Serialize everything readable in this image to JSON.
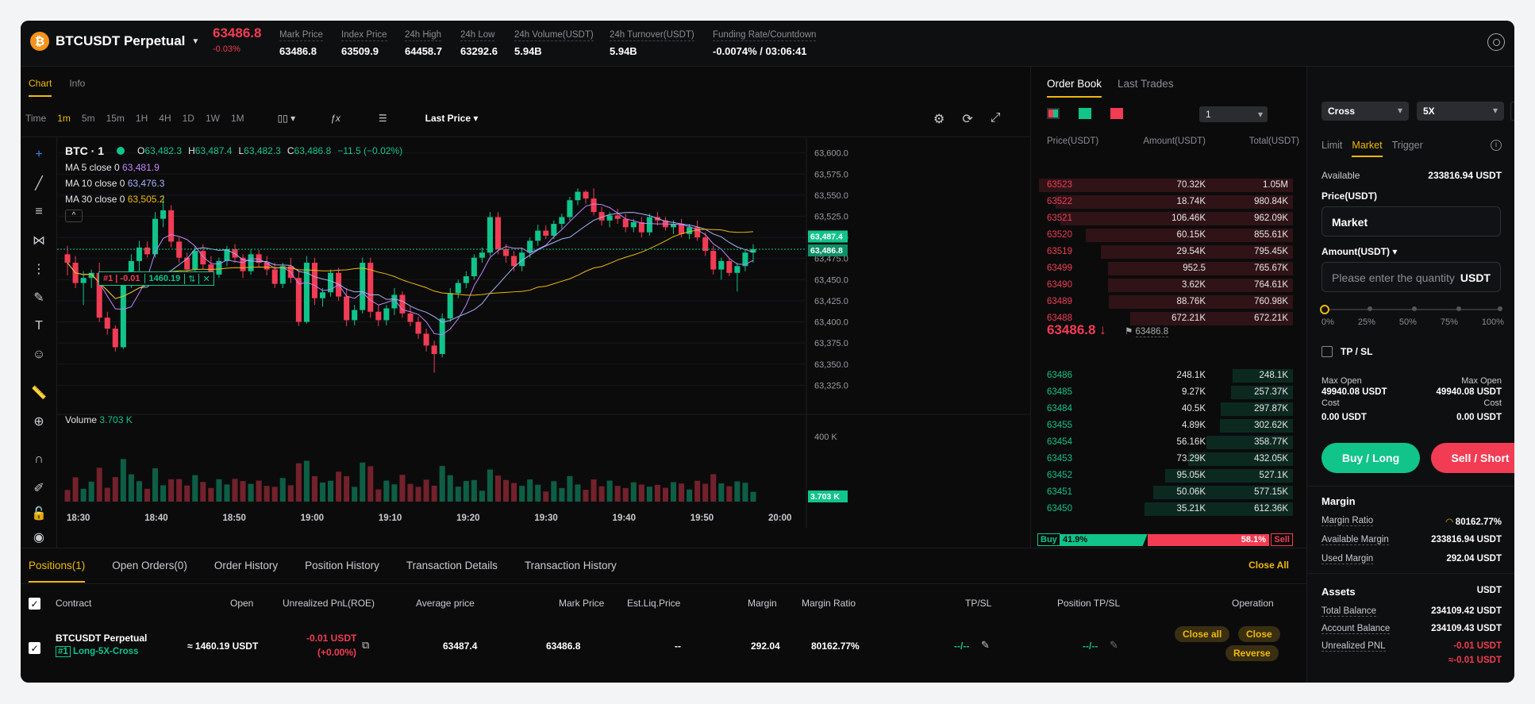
{
  "header": {
    "symbol": "BTCUSDT Perpetual",
    "last_price": "63486.8",
    "change_pct": "-0.03%",
    "stats": [
      {
        "label": "Mark Price",
        "value": "63486.8"
      },
      {
        "label": "Index Price",
        "value": "63509.9"
      },
      {
        "label": "24h High",
        "value": "64458.7"
      },
      {
        "label": "24h Low",
        "value": "63292.6"
      },
      {
        "label": "24h Volume(USDT)",
        "value": "5.94B"
      },
      {
        "label": "24h Turnover(USDT)",
        "value": "5.94B"
      },
      {
        "label": "Funding Rate/Countdown",
        "value": "-0.0074% / 03:06:41"
      }
    ]
  },
  "chart_tabs": {
    "chart": "Chart",
    "info": "Info"
  },
  "timeframes": [
    "Time",
    "1m",
    "5m",
    "15m",
    "1H",
    "4H",
    "1D",
    "1W",
    "1M"
  ],
  "price_source": "Last Price",
  "legend": {
    "title": "BTC · 1",
    "o_label": "O",
    "o": "63,482.3",
    "h_label": "H",
    "h": "63,487.4",
    "l_label": "L",
    "l": "63,482.3",
    "c_label": "C",
    "c": "63,486.8",
    "chg": "−11.5 (−0.02%)",
    "ma5_label": "MA 5 close 0",
    "ma5": "63,481.9",
    "ma10_label": "MA 10 close 0",
    "ma10": "63,476.3",
    "ma30_label": "MA 30 close 0",
    "ma30": "63,505.2",
    "volume_label": "Volume",
    "volume": "3.703 K"
  },
  "position_tag": {
    "id": "#1 | -0.01",
    "size": "1460.19"
  },
  "price_badges": {
    "last": "63,487.4",
    "mark": "63,486.8",
    "vol": "3.703 K"
  },
  "volume_axis_label": "400 K",
  "chart_data": {
    "type": "candlestick",
    "y_ticks": [
      "63,600.0",
      "63,575.0",
      "63,550.0",
      "63,525.0",
      "63,500.0",
      "63,475.0",
      "63,450.0",
      "63,425.0",
      "63,400.0",
      "63,375.0",
      "63,350.0",
      "63,325.0"
    ],
    "ylim": [
      63300,
      63610
    ],
    "x_ticks": [
      "18:30",
      "18:40",
      "18:50",
      "19:00",
      "19:10",
      "19:20",
      "19:30",
      "19:40",
      "19:50",
      "20:00"
    ],
    "candles": [
      [
        63480,
        63490,
        63455,
        63470
      ],
      [
        63470,
        63478,
        63440,
        63446
      ],
      [
        63446,
        63460,
        63420,
        63452
      ],
      [
        63452,
        63462,
        63440,
        63458
      ],
      [
        63458,
        63470,
        63400,
        63405
      ],
      [
        63405,
        63412,
        63385,
        63392
      ],
      [
        63392,
        63396,
        63365,
        63370
      ],
      [
        63370,
        63455,
        63368,
        63450
      ],
      [
        63450,
        63480,
        63440,
        63472
      ],
      [
        63472,
        63496,
        63460,
        63488
      ],
      [
        63488,
        63495,
        63476,
        63480
      ],
      [
        63480,
        63530,
        63476,
        63522
      ],
      [
        63522,
        63550,
        63512,
        63532
      ],
      [
        63532,
        63538,
        63488,
        63495
      ],
      [
        63495,
        63500,
        63470,
        63476
      ],
      [
        63476,
        63482,
        63458,
        63462
      ],
      [
        63462,
        63490,
        63458,
        63484
      ],
      [
        63484,
        63492,
        63462,
        63468
      ],
      [
        63468,
        63478,
        63448,
        63456
      ],
      [
        63456,
        63476,
        63452,
        63472
      ],
      [
        63472,
        63490,
        63466,
        63486
      ],
      [
        63486,
        63492,
        63470,
        63476
      ],
      [
        63476,
        63480,
        63452,
        63460
      ],
      [
        63460,
        63486,
        63456,
        63480
      ],
      [
        63480,
        63485,
        63465,
        63470
      ],
      [
        63470,
        63478,
        63455,
        63462
      ],
      [
        63462,
        63470,
        63440,
        63445
      ],
      [
        63445,
        63470,
        63440,
        63466
      ],
      [
        63466,
        63476,
        63446,
        63452
      ],
      [
        63452,
        63460,
        63395,
        63400
      ],
      [
        63400,
        63478,
        63398,
        63470
      ],
      [
        63470,
        63476,
        63420,
        63428
      ],
      [
        63428,
        63440,
        63418,
        63435
      ],
      [
        63435,
        63462,
        63430,
        63458
      ],
      [
        63458,
        63464,
        63425,
        63430
      ],
      [
        63430,
        63440,
        63395,
        63402
      ],
      [
        63402,
        63420,
        63396,
        63414
      ],
      [
        63414,
        63476,
        63410,
        63470
      ],
      [
        63470,
        63476,
        63405,
        63412
      ],
      [
        63412,
        63420,
        63395,
        63402
      ],
      [
        63402,
        63420,
        63396,
        63416
      ],
      [
        63416,
        63440,
        63408,
        63432
      ],
      [
        63432,
        63436,
        63405,
        63410
      ],
      [
        63410,
        63418,
        63395,
        63400
      ],
      [
        63400,
        63406,
        63380,
        63386
      ],
      [
        63386,
        63392,
        63365,
        63372
      ],
      [
        63372,
        63378,
        63340,
        63362
      ],
      [
        63362,
        63410,
        63358,
        63404
      ],
      [
        63404,
        63440,
        63400,
        63434
      ],
      [
        63434,
        63450,
        63428,
        63446
      ],
      [
        63446,
        63460,
        63440,
        63454
      ],
      [
        63454,
        63480,
        63450,
        63476
      ],
      [
        63476,
        63488,
        63470,
        63482
      ],
      [
        63482,
        63530,
        63478,
        63524
      ],
      [
        63524,
        63530,
        63480,
        63486
      ],
      [
        63486,
        63492,
        63470,
        63478
      ],
      [
        63478,
        63484,
        63460,
        63466
      ],
      [
        63466,
        63488,
        63460,
        63482
      ],
      [
        63482,
        63500,
        63476,
        63496
      ],
      [
        63496,
        63515,
        63490,
        63508
      ],
      [
        63508,
        63514,
        63498,
        63502
      ],
      [
        63502,
        63520,
        63498,
        63516
      ],
      [
        63516,
        63528,
        63510,
        63524
      ],
      [
        63524,
        63548,
        63520,
        63544
      ],
      [
        63544,
        63558,
        63538,
        63554
      ],
      [
        63554,
        63556,
        63540,
        63546
      ],
      [
        63546,
        63558,
        63526,
        63530
      ],
      [
        63530,
        63536,
        63514,
        63520
      ],
      [
        63520,
        63530,
        63512,
        63526
      ],
      [
        63526,
        63534,
        63516,
        63522
      ],
      [
        63522,
        63528,
        63506,
        63512
      ],
      [
        63512,
        63522,
        63506,
        63518
      ],
      [
        63518,
        63524,
        63500,
        63506
      ],
      [
        63506,
        63528,
        63502,
        63524
      ],
      [
        63524,
        63530,
        63514,
        63520
      ],
      [
        63520,
        63524,
        63508,
        63512
      ],
      [
        63512,
        63520,
        63504,
        63516
      ],
      [
        63516,
        63522,
        63500,
        63504
      ],
      [
        63504,
        63516,
        63498,
        63512
      ],
      [
        63512,
        63520,
        63496,
        63500
      ],
      [
        63500,
        63506,
        63478,
        63484
      ],
      [
        63484,
        63490,
        63456,
        63462
      ],
      [
        63462,
        63476,
        63450,
        63472
      ],
      [
        63472,
        63476,
        63454,
        63458
      ],
      [
        63458,
        63470,
        63436,
        63466
      ],
      [
        63466,
        63486,
        63460,
        63482
      ],
      [
        63482,
        63492,
        63470,
        63486
      ]
    ],
    "volume_max": 400
  },
  "orderbook": {
    "tabs": [
      "Order Book",
      "Last Trades"
    ],
    "depth": "1",
    "headers": [
      "Price(USDT)",
      "Amount(USDT)",
      "Total(USDT)"
    ],
    "asks": [
      [
        "63523",
        "70.32K",
        "1.05M"
      ],
      [
        "63522",
        "18.74K",
        "980.84K"
      ],
      [
        "63521",
        "106.46K",
        "962.09K"
      ],
      [
        "63520",
        "60.15K",
        "855.61K"
      ],
      [
        "63519",
        "29.54K",
        "795.45K"
      ],
      [
        "63499",
        "952.5",
        "765.67K"
      ],
      [
        "63490",
        "3.62K",
        "764.61K"
      ],
      [
        "63489",
        "88.76K",
        "760.98K"
      ],
      [
        "63488",
        "672.21K",
        "672.21K"
      ]
    ],
    "mid_price": "63486.8 ↓",
    "mid_mark": "63486.8",
    "bids": [
      [
        "63486",
        "248.1K",
        "248.1K"
      ],
      [
        "63485",
        "9.27K",
        "257.37K"
      ],
      [
        "63484",
        "40.5K",
        "297.87K"
      ],
      [
        "63455",
        "4.89K",
        "302.62K"
      ],
      [
        "63454",
        "56.16K",
        "358.77K"
      ],
      [
        "63453",
        "73.29K",
        "432.05K"
      ],
      [
        "63452",
        "95.05K",
        "527.1K"
      ],
      [
        "63451",
        "50.06K",
        "577.15K"
      ],
      [
        "63450",
        "35.21K",
        "612.36K"
      ]
    ],
    "buy_label": "Buy",
    "buy_pct": "41.9%",
    "sell_label": "Sell",
    "sell_pct": "58.1%",
    "buy_ratio": 0.419
  },
  "order_panel": {
    "margin_mode": "Cross",
    "leverage": "5X",
    "order_types": [
      "Limit",
      "Market",
      "Trigger"
    ],
    "available_label": "Available",
    "available": "233816.94 USDT",
    "price_label": "Price(USDT)",
    "price_value": "Market",
    "amount_label": "Amount(USDT)",
    "amount_placeholder": "Please enter the quantity",
    "amount_unit": "USDT",
    "slider_marks": [
      "0%",
      "25%",
      "50%",
      "75%",
      "100%"
    ],
    "tpsl_label": "TP / SL",
    "max_open_label": "Max Open",
    "max_open_long": "49940.08 USDT",
    "max_open_short": "49940.08 USDT",
    "cost_label": "Cost",
    "cost_long": "0.00 USDT",
    "cost_short": "0.00 USDT",
    "buy_btn": "Buy / Long",
    "sell_btn": "Sell / Short",
    "margin_title": "Margin",
    "margin_ratio_label": "Margin Ratio",
    "margin_ratio": "80162.77%",
    "available_margin_label": "Available Margin",
    "available_margin": "233816.94 USDT",
    "used_margin_label": "Used Margin",
    "used_margin": "292.04 USDT",
    "assets_title": "Assets",
    "assets_unit": "USDT",
    "total_balance_label": "Total Balance",
    "total_balance": "234109.42 USDT",
    "account_balance_label": "Account Balance",
    "account_balance": "234109.43 USDT",
    "unrealized_label": "Unrealized PNL",
    "unrealized": "-0.01 USDT",
    "unrealized2": "≈-0.01 USDT"
  },
  "positions": {
    "tabs": [
      "Positions(1)",
      "Open Orders(0)",
      "Order History",
      "Position History",
      "Transaction Details",
      "Transaction History"
    ],
    "close_all": "Close All",
    "headers": [
      "Contract",
      "Open",
      "Unrealized PnL(ROE)",
      "Average price",
      "Mark Price",
      "Est.Liq.Price",
      "Margin",
      "Margin Ratio",
      "TP/SL",
      "Position TP/SL",
      "Operation"
    ],
    "row": {
      "contract": "BTCUSDT Perpetual",
      "tag": "#1",
      "side": "Long-5X-Cross",
      "open": "≈ 1460.19 USDT",
      "pnl": "-0.01 USDT",
      "roe": "(+0.00%)",
      "avg": "63487.4",
      "mark": "63486.8",
      "liq": "--",
      "margin": "292.04",
      "ratio": "80162.77%",
      "tpsl": "--/--",
      "pos_tpsl": "--/--",
      "op_close_all": "Close all",
      "op_close": "Close",
      "op_reverse": "Reverse"
    }
  }
}
